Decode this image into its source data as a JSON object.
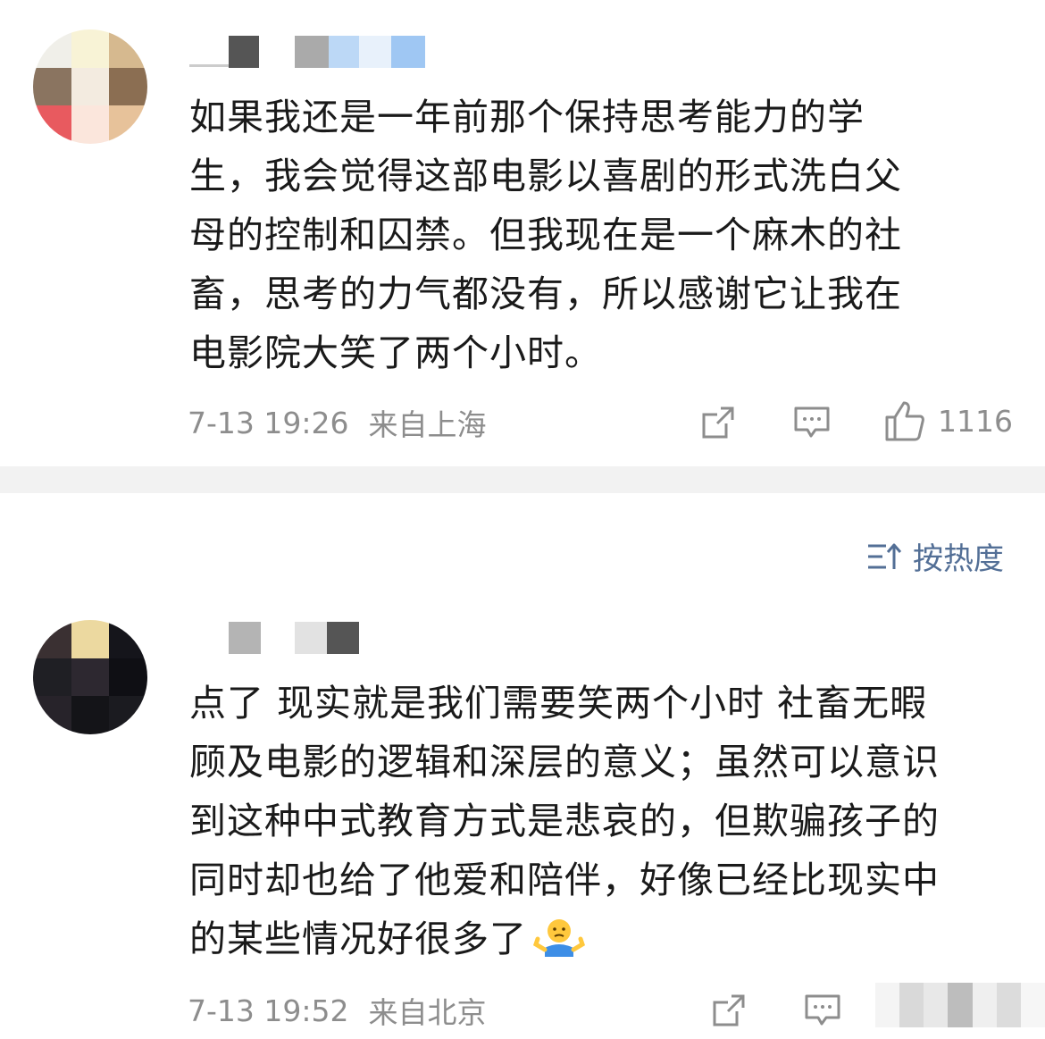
{
  "comments": [
    {
      "username": "1_ ...",
      "text": "如果我还是一年前那个保持思考能力的学生，我会觉得这部电影以喜剧的形式洗白父母的控制和囚禁。但我现在是一个麻木的社畜，思考的力气都没有，所以感谢它让我在电影院大笑了两个小时。",
      "lines": [
        "如果我还是一年前那个保持思考能力的学",
        "生，我会觉得这部电影以喜剧的形式洗白父",
        "母的控制和囚禁。但我现在是一个麻木的社",
        "畜，思考的力气都没有，所以感谢它让我在",
        "电影院大笑了两个小时。"
      ],
      "time": "7-13 19:26",
      "location": "来自上海",
      "like_count": "1116"
    },
    {
      "username": "...",
      "lines": [
        "点了 现实就是我们需要笑两个小时 社畜无暇",
        "顾及电影的逻辑和深层的意义；虽然可以意识",
        "到这种中式教育方式是悲哀的，但欺骗孩子的",
        "同时却也给了他爱和陪伴，好像已经比现实中",
        "的某些情况好很多了"
      ],
      "time": "7-13 19:52",
      "location": "来自北京"
    }
  ],
  "sort": {
    "label": "按热度",
    "icon": "sort-icon"
  },
  "icons": {
    "share": "share-icon",
    "comment": "comment-icon",
    "like": "thumbs-up-icon",
    "emoji": "shrug-emoji-icon"
  },
  "colors": {
    "text": "#1a1a1a",
    "meta": "#8d8d8d",
    "accent": "#536f96",
    "divider": "#f2f2f2"
  }
}
